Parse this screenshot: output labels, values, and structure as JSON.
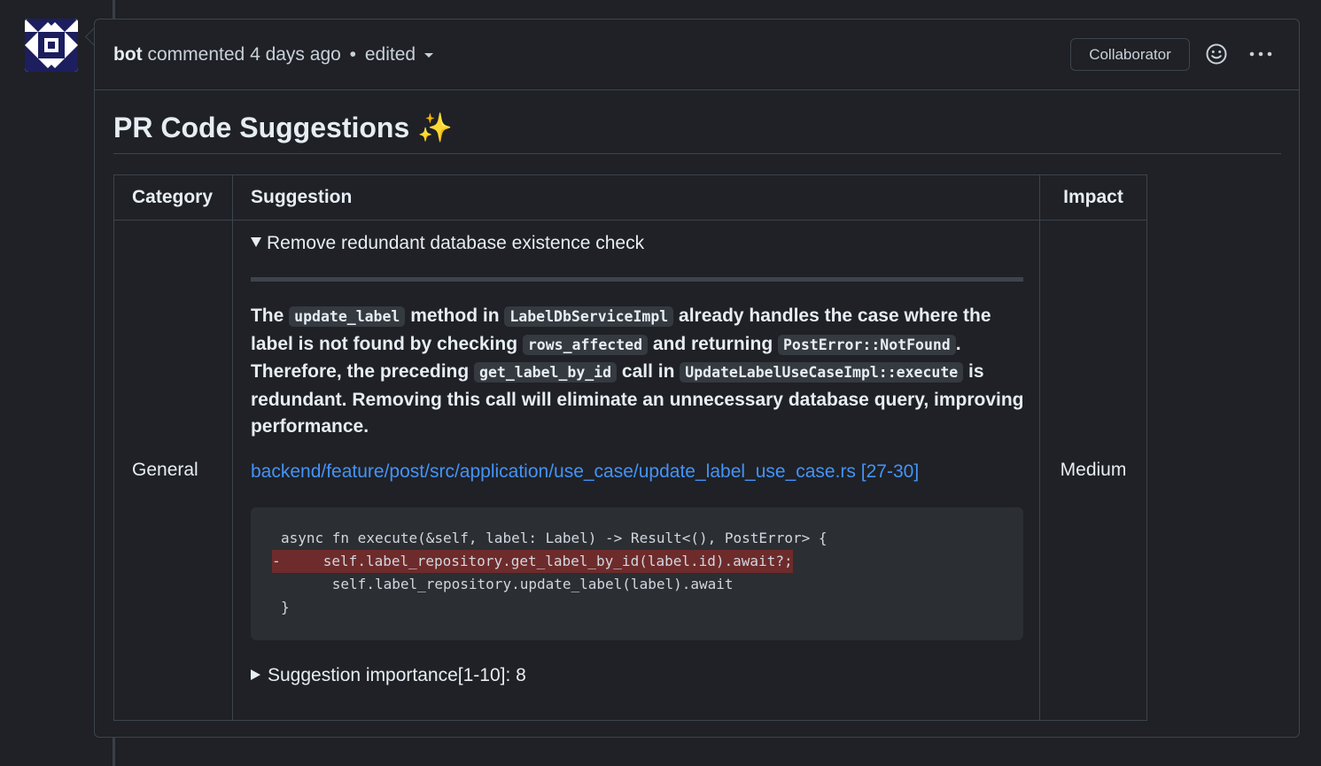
{
  "comment": {
    "author": "bot",
    "action": "commented",
    "time": "4 days ago",
    "separator": "•",
    "edited": "edited",
    "role_badge": "Collaborator"
  },
  "title": "PR Code Suggestions ✨",
  "table": {
    "headers": {
      "category": "Category",
      "suggestion": "Suggestion",
      "impact": "Impact"
    },
    "row": {
      "category": "General",
      "impact": "Medium",
      "summary": "Remove redundant database existence check",
      "description_parts": [
        "The ",
        "update_label",
        " method in ",
        "LabelDbServiceImpl",
        " already handles the case where the label is not found by checking ",
        "rows_affected",
        " and returning ",
        "PostError::NotFound",
        ". Therefore, the preceding ",
        "get_label_by_id",
        " call in ",
        "UpdateLabelUseCaseImpl::execute",
        " is redundant. Removing this call will eliminate an unnecessary database query, improving performance."
      ],
      "file_link": "backend/feature/post/src/application/use_case/update_label_use_case.rs [27-30]",
      "code_lines": [
        "async fn execute(&self, label: Label) -> Result<(), PostError> {",
        "-     self.label_repository.get_label_by_id(label.id).await?;",
        "      self.label_repository.update_label(label).await",
        "}"
      ],
      "importance": "Suggestion importance[1-10]: 8"
    }
  },
  "colors": {
    "background": "#1f2126",
    "border": "#3d444d",
    "link": "#4493f8",
    "removed_line": "#6e2b2b",
    "code_bg": "#2b2e33"
  },
  "icons": {
    "avatar": "identicon-avatar",
    "reaction": "smiley-icon",
    "more": "kebab-horizontal-icon",
    "dropdown": "caret-down-icon",
    "expanded": "triangle-down-icon",
    "collapsed": "triangle-right-icon"
  }
}
